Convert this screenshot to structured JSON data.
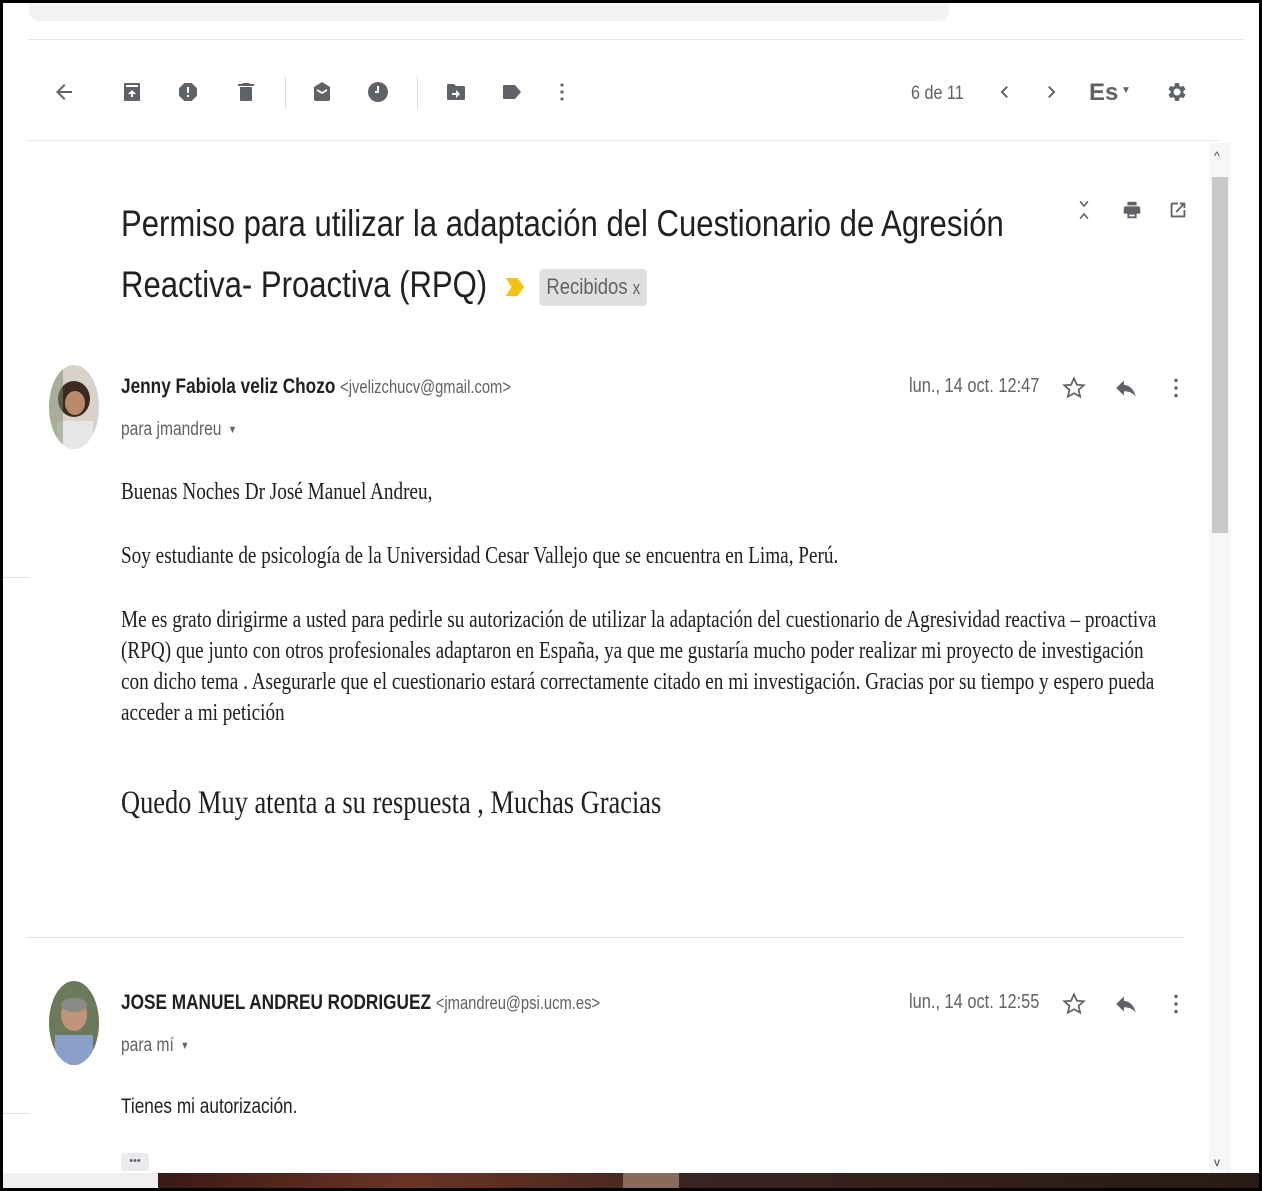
{
  "toolbar": {
    "back_icon": "arrow-left-icon",
    "archive_icon": "archive-icon",
    "spam_icon": "report-spam-icon",
    "delete_icon": "trash-icon",
    "mark_unread_icon": "mark-unread-icon",
    "snooze_icon": "clock-icon",
    "move_icon": "move-to-icon",
    "label_icon": "label-icon",
    "more_icon": "more-vert-icon",
    "pager": "6 de 11",
    "prev_icon": "chevron-left-icon",
    "next_icon": "chevron-right-icon",
    "language": "Es",
    "settings_icon": "gear-icon"
  },
  "subject": {
    "line1": "Permiso para utilizar la adaptación del Cuestionario de Agresión",
    "line2": "Reactiva- Proactiva (RPQ)",
    "label": "Recibidos",
    "label_remove": "x",
    "actions": [
      "expand-collapse-icon",
      "print-icon",
      "open-new-window-icon"
    ]
  },
  "messages": [
    {
      "sender_name": "Jenny Fabiola veliz Chozo",
      "sender_email": "<jvelizchucv@gmail.com>",
      "to": "para jmandreu",
      "date": "lun., 14 oct. 12:47",
      "body": [
        "Buenas Noches  Dr José Manuel Andreu,",
        "Soy estudiante de  psicología de la Universidad Cesar Vallejo que se encuentra en Lima, Perú.",
        "Me es grato  dirigirme a usted  para  pedirle su autorización de utilizar la adaptación del cuestionario de Agresividad reactiva – proactiva (RPQ) que junto con otros profesionales adaptaron en España, ya que me gustaría mucho poder realizar mi proyecto de investigación con dicho tema  . Asegurarle que el cuestionario estará correctamente citado en mi investigación. Gracias por su tiempo y espero pueda acceder a mi petición",
        "Quedo Muy atenta  a su respuesta , Muchas Gracias"
      ]
    },
    {
      "sender_name": "JOSE MANUEL ANDREU RODRIGUEZ",
      "sender_email": "<jmandreu@psi.ucm.es>",
      "to": "para mí",
      "date": "lun., 14 oct. 12:55",
      "body": [
        "Tienes mi autorización."
      ],
      "trimmed_content_button": "•••"
    }
  ],
  "colors": {
    "icon_gray": "#5f6368",
    "importance_marker": "#f4c20d",
    "label_chip_bg": "#e0e0e0"
  }
}
